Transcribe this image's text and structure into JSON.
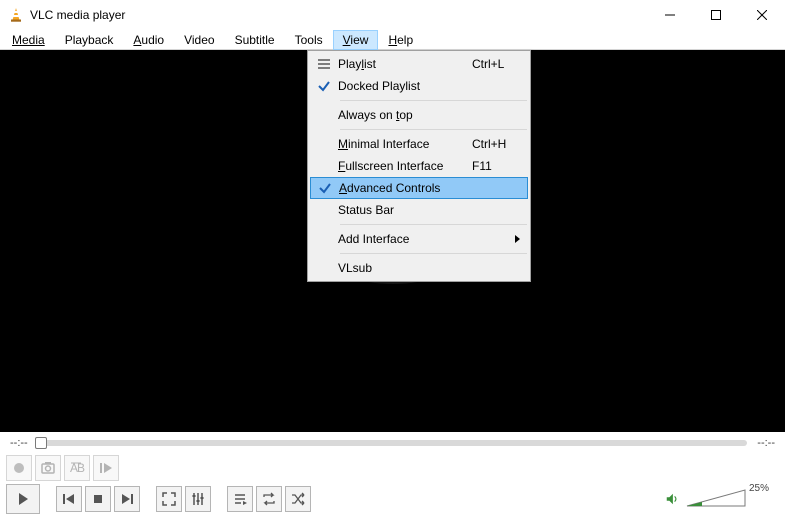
{
  "window": {
    "title": "VLC media player"
  },
  "menubar": {
    "items": [
      {
        "label": "Media",
        "mnemonic_index": 0
      },
      {
        "label": "Playback",
        "mnemonic_index": -1
      },
      {
        "label": "Audio",
        "mnemonic_index": 0
      },
      {
        "label": "Video",
        "mnemonic_index": -1
      },
      {
        "label": "Subtitle",
        "mnemonic_index": -1
      },
      {
        "label": "Tools",
        "mnemonic_index": -1
      },
      {
        "label": "View",
        "mnemonic_index": 0
      },
      {
        "label": "Help",
        "mnemonic_index": 0
      }
    ],
    "open_index": 6
  },
  "dropdown": {
    "items": [
      {
        "type": "item",
        "label": "Playlist",
        "mnemonic_index": 4,
        "accel": "Ctrl+L",
        "icon": "list"
      },
      {
        "type": "item",
        "label": "Docked Playlist",
        "checked": true
      },
      {
        "type": "sep"
      },
      {
        "type": "item",
        "label": "Always on top",
        "mnemonic_index": 10
      },
      {
        "type": "sep"
      },
      {
        "type": "item",
        "label": "Minimal Interface",
        "mnemonic_index": 0,
        "accel": "Ctrl+H"
      },
      {
        "type": "item",
        "label": "Fullscreen Interface",
        "mnemonic_index": 0,
        "accel": "F11"
      },
      {
        "type": "item",
        "label": "Advanced Controls",
        "mnemonic_index": 0,
        "checked": true,
        "highlight": true
      },
      {
        "type": "item",
        "label": "Status Bar"
      },
      {
        "type": "sep"
      },
      {
        "type": "item",
        "label": "Add Interface",
        "submenu": true
      },
      {
        "type": "sep"
      },
      {
        "type": "item",
        "label": "VLsub"
      }
    ]
  },
  "seek": {
    "left_time": "--:--",
    "right_time": "--:--"
  },
  "volume": {
    "percent": "25%"
  },
  "colors": {
    "menu_highlight": "#91c9f7",
    "menu_open_bg": "#cce8ff",
    "cone_orange": "#f5a623"
  }
}
